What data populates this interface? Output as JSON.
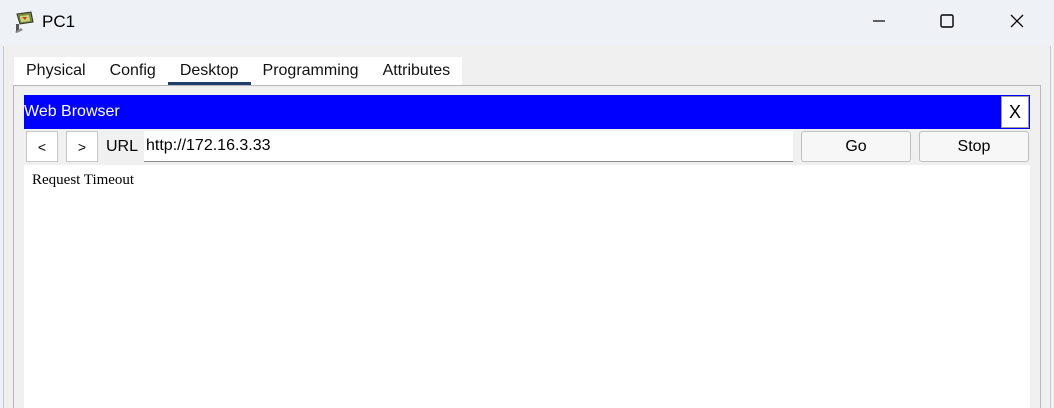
{
  "window": {
    "title": "PC1",
    "icon": "pc-device-icon",
    "controls": [
      "minimize-icon",
      "maximize-icon",
      "close-icon"
    ]
  },
  "tabs": [
    {
      "label": "Physical",
      "active": false
    },
    {
      "label": "Config",
      "active": false
    },
    {
      "label": "Desktop",
      "active": true
    },
    {
      "label": "Programming",
      "active": false
    },
    {
      "label": "Attributes",
      "active": false
    }
  ],
  "browser": {
    "title": "Web Browser",
    "close_label": "X",
    "back_label": "<",
    "forward_label": ">",
    "url_label": "URL",
    "url_value": "http://172.16.3.33",
    "go_label": "Go",
    "stop_label": "Stop",
    "content_text": "Request Timeout"
  },
  "colors": {
    "header_blue": "#0000ff",
    "active_tab_underline": "#1e3d6b",
    "background": "#eef1f6"
  }
}
